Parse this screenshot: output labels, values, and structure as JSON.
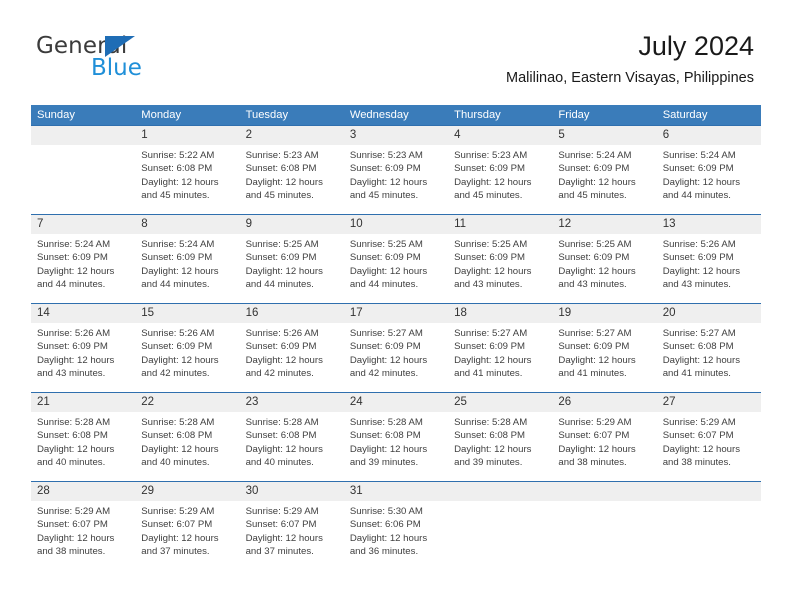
{
  "brand": {
    "name_top": "General",
    "name_bottom": "Blue",
    "triangle_color": "#1f6db5",
    "blue_color": "#1f8fd8"
  },
  "header": {
    "title": "July 2024",
    "subtitle": "Malilinao, Eastern Visayas, Philippines"
  },
  "theme": {
    "header_row_bg": "#3a7cba",
    "week_separator": "#2f6fae",
    "daynum_band_bg": "#efefef"
  },
  "weekdays": [
    "Sunday",
    "Monday",
    "Tuesday",
    "Wednesday",
    "Thursday",
    "Friday",
    "Saturday"
  ],
  "weeks": [
    [
      {
        "day": "",
        "sunrise": "",
        "sunset": "",
        "daylight_line1": "",
        "daylight_line2": ""
      },
      {
        "day": "1",
        "sunrise": "Sunrise: 5:22 AM",
        "sunset": "Sunset: 6:08 PM",
        "daylight_line1": "Daylight: 12 hours",
        "daylight_line2": "and 45 minutes."
      },
      {
        "day": "2",
        "sunrise": "Sunrise: 5:23 AM",
        "sunset": "Sunset: 6:08 PM",
        "daylight_line1": "Daylight: 12 hours",
        "daylight_line2": "and 45 minutes."
      },
      {
        "day": "3",
        "sunrise": "Sunrise: 5:23 AM",
        "sunset": "Sunset: 6:09 PM",
        "daylight_line1": "Daylight: 12 hours",
        "daylight_line2": "and 45 minutes."
      },
      {
        "day": "4",
        "sunrise": "Sunrise: 5:23 AM",
        "sunset": "Sunset: 6:09 PM",
        "daylight_line1": "Daylight: 12 hours",
        "daylight_line2": "and 45 minutes."
      },
      {
        "day": "5",
        "sunrise": "Sunrise: 5:24 AM",
        "sunset": "Sunset: 6:09 PM",
        "daylight_line1": "Daylight: 12 hours",
        "daylight_line2": "and 45 minutes."
      },
      {
        "day": "6",
        "sunrise": "Sunrise: 5:24 AM",
        "sunset": "Sunset: 6:09 PM",
        "daylight_line1": "Daylight: 12 hours",
        "daylight_line2": "and 44 minutes."
      }
    ],
    [
      {
        "day": "7",
        "sunrise": "Sunrise: 5:24 AM",
        "sunset": "Sunset: 6:09 PM",
        "daylight_line1": "Daylight: 12 hours",
        "daylight_line2": "and 44 minutes."
      },
      {
        "day": "8",
        "sunrise": "Sunrise: 5:24 AM",
        "sunset": "Sunset: 6:09 PM",
        "daylight_line1": "Daylight: 12 hours",
        "daylight_line2": "and 44 minutes."
      },
      {
        "day": "9",
        "sunrise": "Sunrise: 5:25 AM",
        "sunset": "Sunset: 6:09 PM",
        "daylight_line1": "Daylight: 12 hours",
        "daylight_line2": "and 44 minutes."
      },
      {
        "day": "10",
        "sunrise": "Sunrise: 5:25 AM",
        "sunset": "Sunset: 6:09 PM",
        "daylight_line1": "Daylight: 12 hours",
        "daylight_line2": "and 44 minutes."
      },
      {
        "day": "11",
        "sunrise": "Sunrise: 5:25 AM",
        "sunset": "Sunset: 6:09 PM",
        "daylight_line1": "Daylight: 12 hours",
        "daylight_line2": "and 43 minutes."
      },
      {
        "day": "12",
        "sunrise": "Sunrise: 5:25 AM",
        "sunset": "Sunset: 6:09 PM",
        "daylight_line1": "Daylight: 12 hours",
        "daylight_line2": "and 43 minutes."
      },
      {
        "day": "13",
        "sunrise": "Sunrise: 5:26 AM",
        "sunset": "Sunset: 6:09 PM",
        "daylight_line1": "Daylight: 12 hours",
        "daylight_line2": "and 43 minutes."
      }
    ],
    [
      {
        "day": "14",
        "sunrise": "Sunrise: 5:26 AM",
        "sunset": "Sunset: 6:09 PM",
        "daylight_line1": "Daylight: 12 hours",
        "daylight_line2": "and 43 minutes."
      },
      {
        "day": "15",
        "sunrise": "Sunrise: 5:26 AM",
        "sunset": "Sunset: 6:09 PM",
        "daylight_line1": "Daylight: 12 hours",
        "daylight_line2": "and 42 minutes."
      },
      {
        "day": "16",
        "sunrise": "Sunrise: 5:26 AM",
        "sunset": "Sunset: 6:09 PM",
        "daylight_line1": "Daylight: 12 hours",
        "daylight_line2": "and 42 minutes."
      },
      {
        "day": "17",
        "sunrise": "Sunrise: 5:27 AM",
        "sunset": "Sunset: 6:09 PM",
        "daylight_line1": "Daylight: 12 hours",
        "daylight_line2": "and 42 minutes."
      },
      {
        "day": "18",
        "sunrise": "Sunrise: 5:27 AM",
        "sunset": "Sunset: 6:09 PM",
        "daylight_line1": "Daylight: 12 hours",
        "daylight_line2": "and 41 minutes."
      },
      {
        "day": "19",
        "sunrise": "Sunrise: 5:27 AM",
        "sunset": "Sunset: 6:09 PM",
        "daylight_line1": "Daylight: 12 hours",
        "daylight_line2": "and 41 minutes."
      },
      {
        "day": "20",
        "sunrise": "Sunrise: 5:27 AM",
        "sunset": "Sunset: 6:08 PM",
        "daylight_line1": "Daylight: 12 hours",
        "daylight_line2": "and 41 minutes."
      }
    ],
    [
      {
        "day": "21",
        "sunrise": "Sunrise: 5:28 AM",
        "sunset": "Sunset: 6:08 PM",
        "daylight_line1": "Daylight: 12 hours",
        "daylight_line2": "and 40 minutes."
      },
      {
        "day": "22",
        "sunrise": "Sunrise: 5:28 AM",
        "sunset": "Sunset: 6:08 PM",
        "daylight_line1": "Daylight: 12 hours",
        "daylight_line2": "and 40 minutes."
      },
      {
        "day": "23",
        "sunrise": "Sunrise: 5:28 AM",
        "sunset": "Sunset: 6:08 PM",
        "daylight_line1": "Daylight: 12 hours",
        "daylight_line2": "and 40 minutes."
      },
      {
        "day": "24",
        "sunrise": "Sunrise: 5:28 AM",
        "sunset": "Sunset: 6:08 PM",
        "daylight_line1": "Daylight: 12 hours",
        "daylight_line2": "and 39 minutes."
      },
      {
        "day": "25",
        "sunrise": "Sunrise: 5:28 AM",
        "sunset": "Sunset: 6:08 PM",
        "daylight_line1": "Daylight: 12 hours",
        "daylight_line2": "and 39 minutes."
      },
      {
        "day": "26",
        "sunrise": "Sunrise: 5:29 AM",
        "sunset": "Sunset: 6:07 PM",
        "daylight_line1": "Daylight: 12 hours",
        "daylight_line2": "and 38 minutes."
      },
      {
        "day": "27",
        "sunrise": "Sunrise: 5:29 AM",
        "sunset": "Sunset: 6:07 PM",
        "daylight_line1": "Daylight: 12 hours",
        "daylight_line2": "and 38 minutes."
      }
    ],
    [
      {
        "day": "28",
        "sunrise": "Sunrise: 5:29 AM",
        "sunset": "Sunset: 6:07 PM",
        "daylight_line1": "Daylight: 12 hours",
        "daylight_line2": "and 38 minutes."
      },
      {
        "day": "29",
        "sunrise": "Sunrise: 5:29 AM",
        "sunset": "Sunset: 6:07 PM",
        "daylight_line1": "Daylight: 12 hours",
        "daylight_line2": "and 37 minutes."
      },
      {
        "day": "30",
        "sunrise": "Sunrise: 5:29 AM",
        "sunset": "Sunset: 6:07 PM",
        "daylight_line1": "Daylight: 12 hours",
        "daylight_line2": "and 37 minutes."
      },
      {
        "day": "31",
        "sunrise": "Sunrise: 5:30 AM",
        "sunset": "Sunset: 6:06 PM",
        "daylight_line1": "Daylight: 12 hours",
        "daylight_line2": "and 36 minutes."
      },
      {
        "day": "",
        "sunrise": "",
        "sunset": "",
        "daylight_line1": "",
        "daylight_line2": ""
      },
      {
        "day": "",
        "sunrise": "",
        "sunset": "",
        "daylight_line1": "",
        "daylight_line2": ""
      },
      {
        "day": "",
        "sunrise": "",
        "sunset": "",
        "daylight_line1": "",
        "daylight_line2": ""
      }
    ]
  ]
}
